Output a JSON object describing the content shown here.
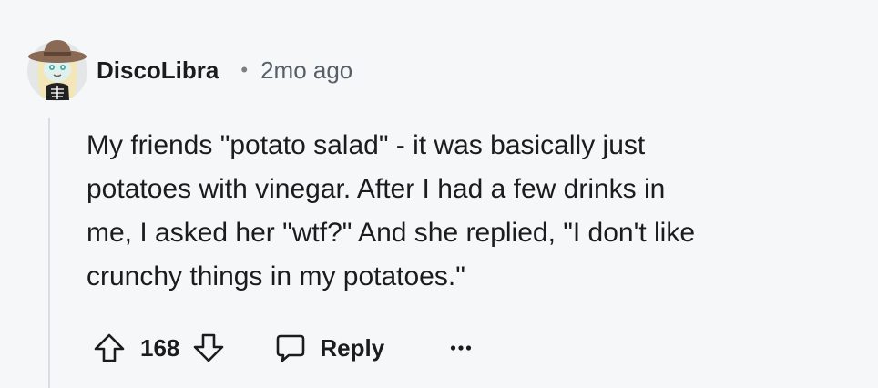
{
  "comment": {
    "author": "DiscoLibra",
    "separator": "•",
    "time_ago": "2mo ago",
    "body_lines": [
      "My friends \"potato salad\" - it was basically just",
      "potatoes with vinegar. After I had a few drinks in",
      "me, I asked her \"wtf?\" And she replied, \"I don't like",
      "crunchy things in my potatoes.\""
    ],
    "score": "168",
    "reply_label": "Reply"
  },
  "icons": {
    "avatar": "avatar-cowgirl-skeleton",
    "upvote": "arrow-up-icon",
    "downvote": "arrow-down-icon",
    "reply": "speech-bubble-icon",
    "more": "more-horizontal-icon"
  },
  "colors": {
    "background": "#f6f7f8",
    "text": "#1c1c1c",
    "meta": "#576069",
    "thread_line": "#d9dce0",
    "hat": "#8a6a55"
  }
}
